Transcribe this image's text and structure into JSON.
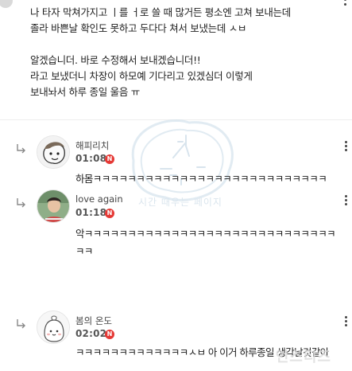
{
  "post": {
    "lines": [
      "나 타자 막쳐가지고 ㅣ를 ㅓ로 쓸 때 많거든 평소엔 고쳐 보내는데",
      "졸라 바쁜날 확인도 못하고 두다다 쳐서 보냈는데 ㅅㅂ",
      "알겠습니더. 바로 수정해서 보내겠습니더!!",
      "라고 보냈더니 차장이 하모예 기다리고 있겠심더 이렇게",
      "보내놔서 하루 종일 울음 ㅠ"
    ]
  },
  "replies": [
    {
      "nickname": "해피리치",
      "time": "01:08",
      "badge": "N",
      "text_lines": [
        "하몸ㅋㅋㅋㅋㅋㅋㅋㅋㅋㅋㅋㅋㅋㅋㅋㅋㅋㅋㅋㅋㅋㅋㅋㅋㅋㅋㅋ"
      ]
    },
    {
      "nickname": "love again",
      "time": "01:18",
      "badge": "N",
      "text_lines": [
        "악ㅋㅋㅋㅋㅋㅋㅋㅋㅋㅋㅋㅋㅋㅋㅋㅋㅋㅋㅋㅋㅋㅋㅋㅋㅋㅋㅋㅋㅋ",
        "ㅋㅋ"
      ]
    },
    {
      "nickname": "봄의 온도",
      "time": "02:02",
      "badge": "N",
      "text_lines": [
        "ㅋㅋㅋㅋㅋㅋㅋㅋㅋㅋㅋㅋㅋㅅㅂ 아 이거 하루종일 생각날것같아"
      ]
    }
  ],
  "watermark": {
    "center_text": "시간 때우는 페이지",
    "corner_text": "인스티즈"
  },
  "colors": {
    "badge": "#e53935",
    "divider": "#eeeeee",
    "text": "#1e1e1e"
  }
}
